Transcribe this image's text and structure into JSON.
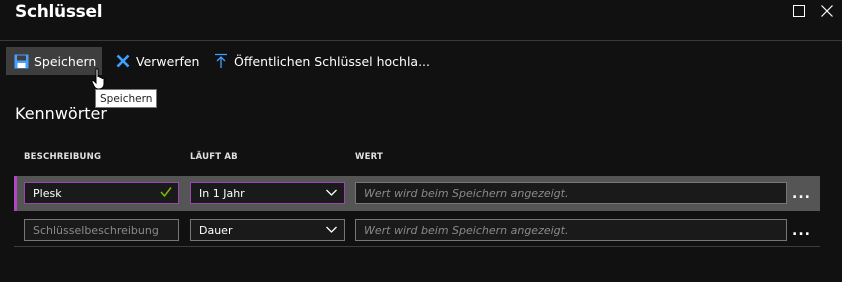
{
  "window": {
    "title": "Schlüssel"
  },
  "toolbar": {
    "save_label": "Speichern",
    "discard_label": "Verwerfen",
    "upload_label": "Öffentlichen Schlüssel hochla..."
  },
  "tooltip": {
    "text": "Speichern"
  },
  "section": {
    "title": "Kennwörter"
  },
  "columns": [
    "BESCHREIBUNG",
    "LÄUFT AB",
    "WERT"
  ],
  "rows": [
    {
      "description": "Plesk",
      "expires": "In 1 Jahr",
      "value_placeholder": "Wert wird beim Speichern angezeigt.",
      "more": "..."
    },
    {
      "description_placeholder": "Schlüsselbeschreibung",
      "expires": "Dauer",
      "value_placeholder": "Wert wird beim Speichern angezeigt.",
      "more": "..."
    }
  ],
  "colors": {
    "accent": "#9a46b0",
    "save_icon": "#4aa0ff",
    "discard_icon": "#3ea0ff",
    "check": "#7fba00"
  }
}
